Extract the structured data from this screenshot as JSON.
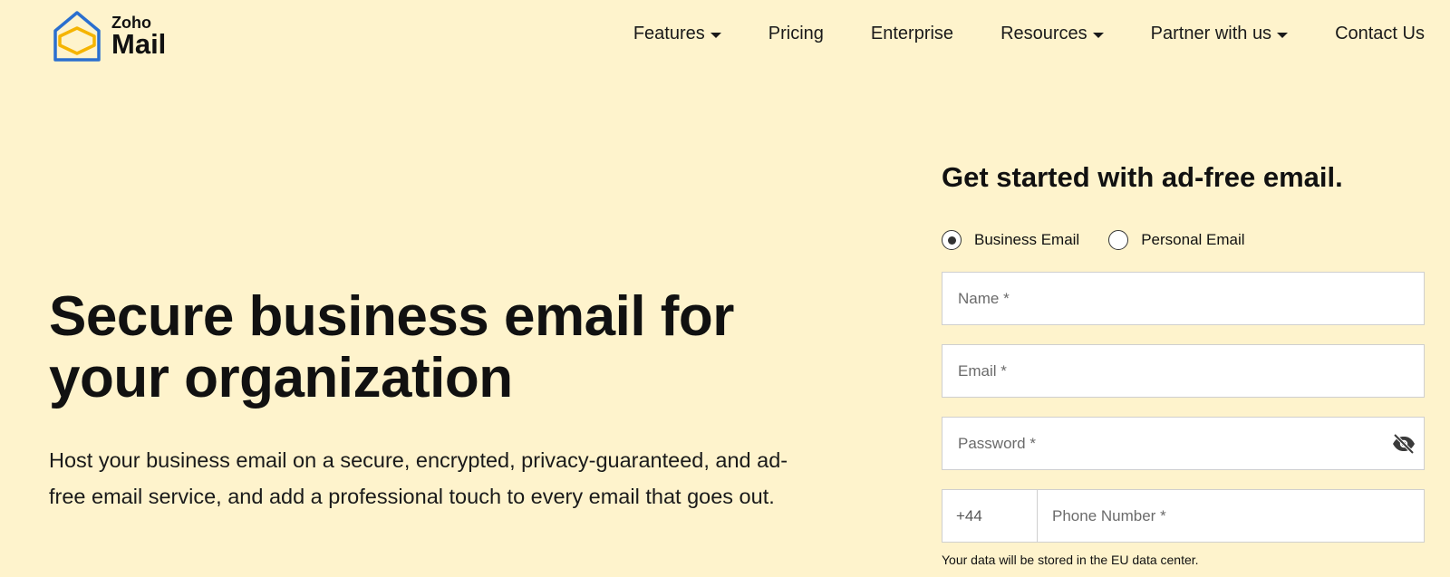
{
  "brand": {
    "name_top": "Zoho",
    "name_main": "Mail",
    "colors": {
      "logo_blue": "#2a6fcf",
      "logo_yellow": "#f5b400"
    }
  },
  "nav": {
    "items": [
      {
        "label": "Features",
        "dropdown": true
      },
      {
        "label": "Pricing",
        "dropdown": false
      },
      {
        "label": "Enterprise",
        "dropdown": false
      },
      {
        "label": "Resources",
        "dropdown": true
      },
      {
        "label": "Partner with us",
        "dropdown": true
      },
      {
        "label": "Contact Us",
        "dropdown": false
      }
    ]
  },
  "hero": {
    "title": "Secure business email for your organization",
    "description": "Host your business email on a secure, encrypted, privacy-guaranteed, and ad-free email service, and add a professional touch to every email that goes out."
  },
  "signup": {
    "title": "Get started with ad-free email.",
    "options": [
      {
        "label": "Business Email",
        "selected": true
      },
      {
        "label": "Personal Email",
        "selected": false
      }
    ],
    "name_placeholder": "Name *",
    "email_placeholder": "Email *",
    "password_placeholder": "Password *",
    "country_code": "+44",
    "phone_placeholder": "Phone Number *",
    "data_note": "Your data will be stored in the EU data center."
  },
  "colors": {
    "background": "#fef3cc",
    "text": "#111111",
    "field_border": "#cfcfcf"
  }
}
